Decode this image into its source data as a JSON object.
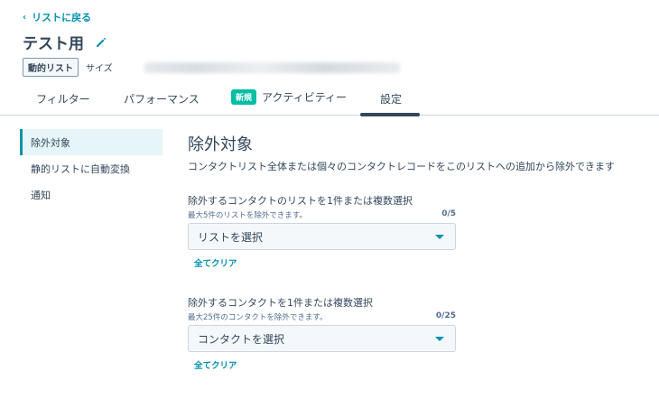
{
  "header": {
    "back_link": "リストに戻る",
    "title": "テスト用",
    "list_type_badge": "動的リスト",
    "size_label": "サイズ"
  },
  "tabs": [
    {
      "label": "フィルター"
    },
    {
      "label": "パフォーマンス"
    },
    {
      "label": "アクティビティー",
      "badge": "新規"
    },
    {
      "label": "設定",
      "active": true
    }
  ],
  "sidebar": {
    "items": [
      {
        "label": "除外対象",
        "active": true
      },
      {
        "label": "静的リストに自動変換"
      },
      {
        "label": "通知"
      }
    ]
  },
  "main": {
    "title": "除外対象",
    "description": "コンタクトリスト全体または個々のコンタクトレコードをこのリストへの追加から除外できます",
    "list_field": {
      "label": "除外するコンタクトのリストを1件または複数選択",
      "help": "最大5件のリストを除外できます。",
      "count": "0/5",
      "placeholder": "リストを選択",
      "clear": "全てクリア"
    },
    "contact_field": {
      "label": "除外するコンタクトを1件または複数選択",
      "help": "最大25件のコンタクトを除外できます。",
      "count": "0/25",
      "placeholder": "コンタクトを選択",
      "clear": "全てクリア"
    }
  },
  "colors": {
    "accent": "#0091ae",
    "text": "#33475b",
    "new_badge": "#00bda5",
    "active_bg": "#e5f5f8"
  }
}
